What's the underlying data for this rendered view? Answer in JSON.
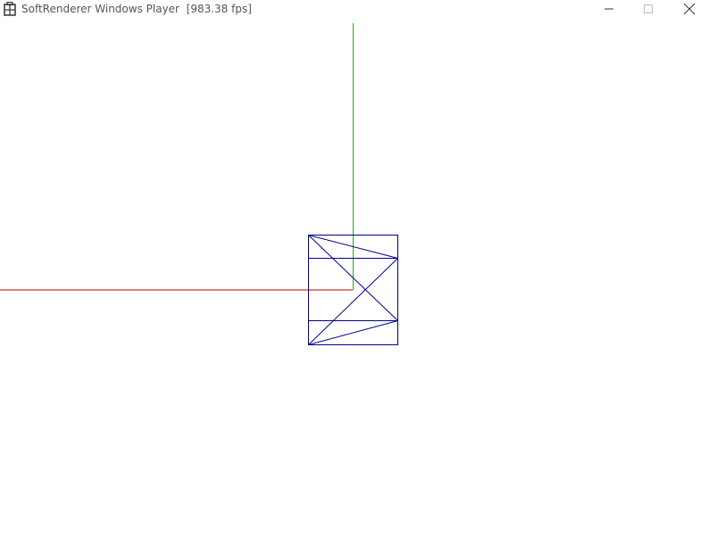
{
  "window": {
    "title": "SoftRenderer Windows Player",
    "fps_label": "[983.38 fps]",
    "app_icon": "building-icon"
  },
  "controls": {
    "minimize_icon": "minimize-icon",
    "maximize_icon": "maximize-icon",
    "close_icon": "close-icon"
  },
  "colors": {
    "x_axis": "#c00000",
    "y_axis": "#00c000",
    "mesh": "#00008b",
    "title_text": "#555555"
  }
}
